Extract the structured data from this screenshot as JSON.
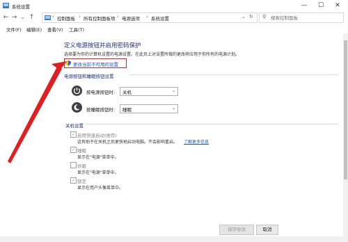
{
  "window": {
    "title": "系统设置",
    "minimize": "—",
    "maximize": "☐",
    "close": "✕"
  },
  "nav": {
    "back": "←",
    "forward": "→",
    "up": "↑",
    "dropdown": "⌄",
    "breadcrumbs": [
      "控制面板",
      "所有控制面板项",
      "电源选项",
      "系统设置"
    ],
    "search_placeholder": "搜索控制面板"
  },
  "menu": [
    "文件(F)",
    "编辑(E)",
    "查看(V)",
    "工具(T)"
  ],
  "main": {
    "title": "定义电源按钮并启用密码保护",
    "description": "选择要为你的计算机设置的电源设置。在此页上对设置所做的更改将应用于你所有的电源计划。",
    "change_link": "更改当前不可用的设置",
    "power_section": {
      "heading": "电源按钮和睡眠按钮设置",
      "rows": [
        {
          "label": "按电源按钮时:",
          "value": "关机"
        },
        {
          "label": "按睡眠按钮时:",
          "value": "睡眠"
        }
      ]
    },
    "shutdown_section": {
      "heading": "关机设置",
      "items": [
        {
          "label": "启用快速启动(推荐)",
          "checked": true,
          "desc": "这有助于在关机之后更快地启动电脑。不会影响重启。",
          "link": "了解更多信息"
        },
        {
          "label": "睡眠",
          "checked": true,
          "desc": "显示在\"电源\"菜单中。"
        },
        {
          "label": "休眠",
          "checked": false,
          "desc": "显示在\"电源\"菜单中。"
        },
        {
          "label": "锁定",
          "checked": true,
          "desc": "显示在用户头像菜单中。"
        }
      ]
    }
  },
  "buttons": {
    "save": "保存修改",
    "cancel": "取消"
  },
  "colors": {
    "title_blue": "#1e3287",
    "link_blue": "#1a56c2",
    "annotation_red": "#e02020"
  }
}
